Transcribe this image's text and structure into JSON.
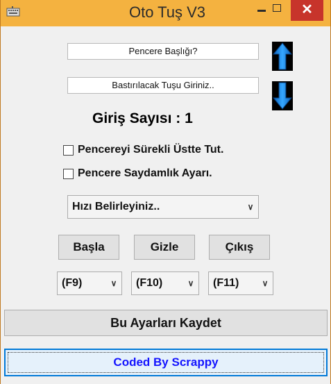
{
  "window": {
    "title": "Oto Tuş V3",
    "controls": {
      "minimize": "–",
      "maximize": "☐",
      "close": "✕"
    }
  },
  "fields": {
    "window_title_placeholder": "Pencere Başlığı?",
    "key_placeholder": "Bastırılacak Tuşu Giriniz.."
  },
  "counter": {
    "text": "Giriş Sayısı : 1"
  },
  "checkboxes": [
    {
      "label": "Pencereyi Sürekli Üstte Tut.",
      "checked": false
    },
    {
      "label": "Pencere Saydamlık Ayarı.",
      "checked": false
    }
  ],
  "speed_select": {
    "value": "Hızı Belirleyiniz.."
  },
  "buttons": {
    "start": "Başla",
    "hide": "Gizle",
    "exit": "Çıkış"
  },
  "hotkeys": {
    "start": "(F9)",
    "hide": "(F10)",
    "exit": "(F11)"
  },
  "save_button": "Bu Ayarları Kaydet",
  "credit_button": "Coded By Scrappy",
  "colors": {
    "titlebar": "#f4b240",
    "close": "#c7342b",
    "arrow": "#1a8cff",
    "credit_text": "#1414ff"
  },
  "icons": {
    "app": "keyboard-icon",
    "up": "arrow-up-icon",
    "down": "arrow-down-icon"
  }
}
